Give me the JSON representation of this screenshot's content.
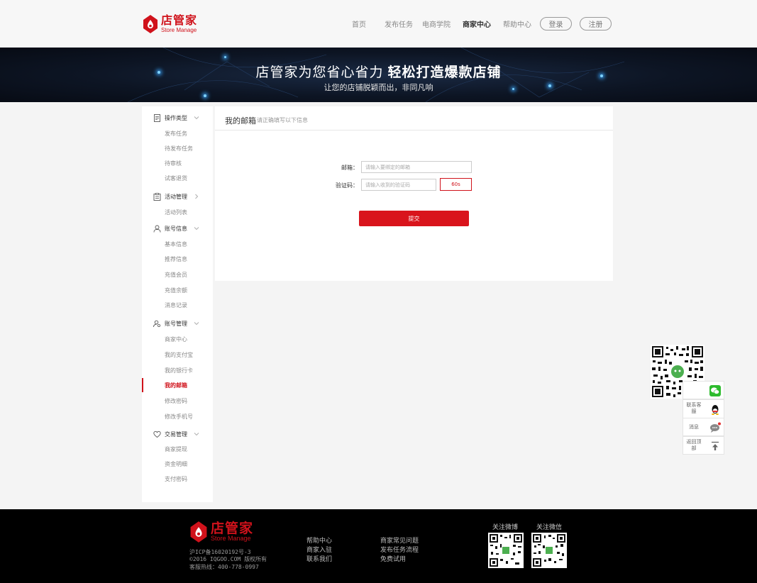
{
  "header": {
    "logo_cn": "店管家",
    "logo_en": "Store Manage",
    "nav": [
      "首页",
      "发布任务",
      "电商学院",
      "商家中心",
      "帮助中心"
    ],
    "login": "登录",
    "register": "注册"
  },
  "banner": {
    "slogan_main": "店管家为您省心省力",
    "slogan_bold": "轻松打造爆款店铺",
    "slogan_sub": "让您的店铺脱颖而出，非同凡响"
  },
  "sidebar": {
    "groups": [
      {
        "label": "操作类型",
        "icon": "document-icon",
        "items": [
          "发布任务",
          "待发布任务",
          "待审核",
          "试客退货"
        ]
      },
      {
        "label": "活动管理",
        "icon": "clipboard-icon",
        "items": [
          "活动列表"
        ]
      },
      {
        "label": "账号信息",
        "icon": "user-icon",
        "items": [
          "基本信息",
          "推荐信息",
          "充值会员",
          "充值余额",
          "消息记录"
        ]
      },
      {
        "label": "账号管理",
        "icon": "user-settings-icon",
        "items": [
          "商家中心",
          "我的支付宝",
          "我的银行卡",
          "我的邮箱",
          "修改密码",
          "修改手机号"
        ]
      },
      {
        "label": "交易管理",
        "icon": "heart-hand-icon",
        "items": [
          "商家提现",
          "资金明细",
          "支付密码"
        ]
      }
    ],
    "active_item": "我的邮箱"
  },
  "main": {
    "title": "我的邮箱",
    "hint": "请正确填写以下信息",
    "email_label": "邮箱：",
    "email_placeholder": "请输入要绑定的邮箱",
    "code_label": "验证码：",
    "code_placeholder": "请输入收到的验证码",
    "code_button": "60s",
    "submit": "提交"
  },
  "float_tools": {
    "contact": "联系客服",
    "message": "消息",
    "top": "返回顶部"
  },
  "footer": {
    "logo_cn": "店管家",
    "logo_en": "Store Manage",
    "icp": "沪ICP备16020192号-3",
    "copyright": "©2016 IQGOO.COM 版权所有",
    "hotline": "客服热线：400-778-0997",
    "links_col1": [
      "帮助中心",
      "商家入驻",
      "联系我们"
    ],
    "links_col2": [
      "商家常见问题",
      "发布任务流程",
      "免费试用"
    ],
    "weibo_label": "关注微博",
    "wechat_label": "关注微信"
  },
  "colors": {
    "brand": "#d0121b",
    "footer_bg": "#000000"
  }
}
